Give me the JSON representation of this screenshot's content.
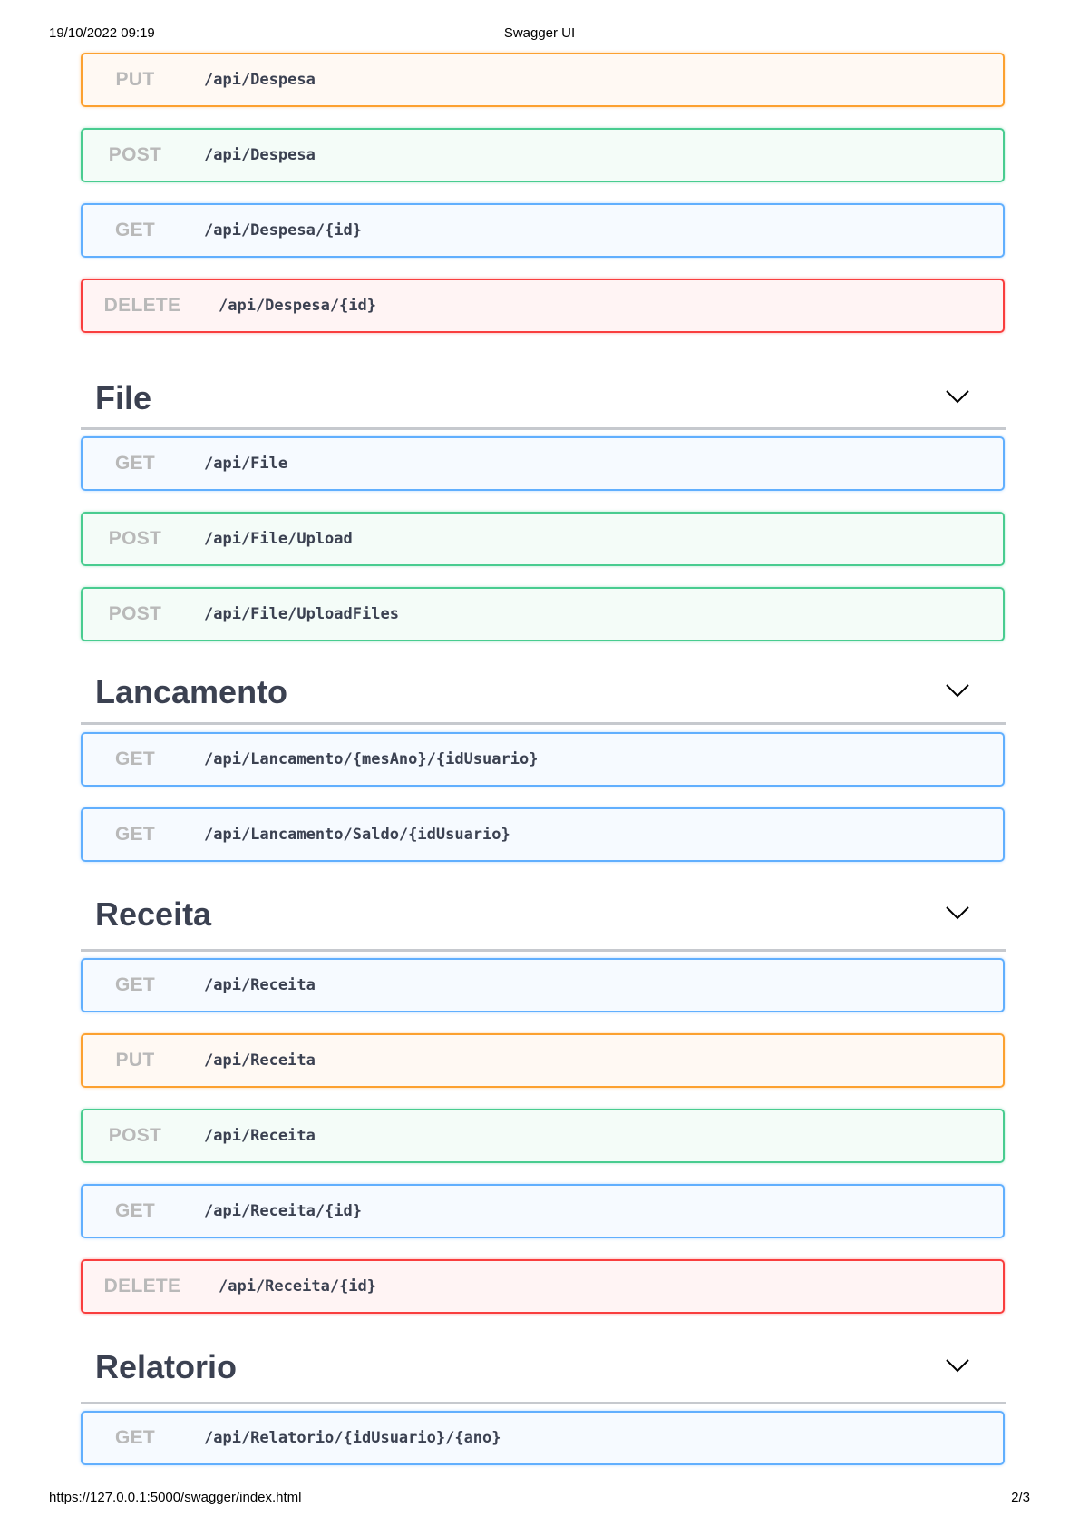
{
  "print_header": {
    "datetime": "19/10/2022 09:19",
    "title": "Swagger UI"
  },
  "print_footer": {
    "url": "https://127.0.0.1:5000/swagger/index.html",
    "page": "2/3"
  },
  "despesa_ops": [
    {
      "method": "PUT",
      "path": "/api/Despesa"
    },
    {
      "method": "POST",
      "path": "/api/Despesa"
    },
    {
      "method": "GET",
      "path": "/api/Despesa/{id}"
    },
    {
      "method": "DELETE",
      "path": "/api/Despesa/{id}"
    }
  ],
  "sections": [
    {
      "name": "File",
      "ops": [
        {
          "method": "GET",
          "path": "/api/File"
        },
        {
          "method": "POST",
          "path": "/api/File/Upload"
        },
        {
          "method": "POST",
          "path": "/api/File/UploadFiles"
        }
      ]
    },
    {
      "name": "Lancamento",
      "ops": [
        {
          "method": "GET",
          "path": "/api/Lancamento/{mesAno}/{idUsuario}"
        },
        {
          "method": "GET",
          "path": "/api/Lancamento/Saldo/{idUsuario}"
        }
      ]
    },
    {
      "name": "Receita",
      "ops": [
        {
          "method": "GET",
          "path": "/api/Receita"
        },
        {
          "method": "PUT",
          "path": "/api/Receita"
        },
        {
          "method": "POST",
          "path": "/api/Receita"
        },
        {
          "method": "GET",
          "path": "/api/Receita/{id}"
        },
        {
          "method": "DELETE",
          "path": "/api/Receita/{id}"
        }
      ]
    },
    {
      "name": "Relatorio",
      "ops": [
        {
          "method": "GET",
          "path": "/api/Relatorio/{idUsuario}/{ano}"
        }
      ]
    }
  ],
  "icons": {
    "expand": "chevron-down-icon"
  },
  "colors": {
    "get": "#61affe",
    "post": "#49cc90",
    "put": "#fca130",
    "delete": "#f93e3e",
    "method_text": "#b9b9b9",
    "text": "#3b4151",
    "divider": "#c6c9ce"
  }
}
